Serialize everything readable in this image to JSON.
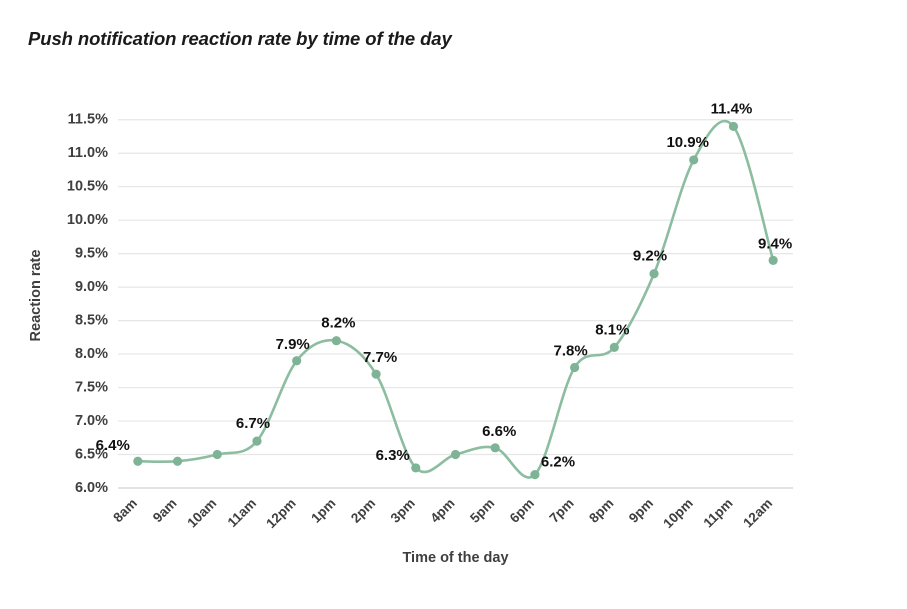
{
  "chart_data": {
    "type": "line",
    "title": "Push notification reaction rate by time of the day",
    "xlabel": "Time of the day",
    "ylabel": "Reaction rate",
    "categories": [
      "8am",
      "9am",
      "10am",
      "11am",
      "12pm",
      "1pm",
      "2pm",
      "3pm",
      "4pm",
      "5pm",
      "6pm",
      "7pm",
      "8pm",
      "9pm",
      "10pm",
      "11pm",
      "12am"
    ],
    "values": [
      6.4,
      6.4,
      6.5,
      6.7,
      7.9,
      8.2,
      7.7,
      6.3,
      6.5,
      6.6,
      6.2,
      7.8,
      8.1,
      9.2,
      10.9,
      11.4,
      9.4
    ],
    "point_labels": [
      "6.4%",
      "",
      "",
      "6.7%",
      "7.9%",
      "8.2%",
      "7.7%",
      "6.3%",
      "",
      "6.6%",
      "6.2%",
      "7.8%",
      "8.1%",
      "9.2%",
      "10.9%",
      "11.4%",
      "9.4%"
    ],
    "ylim": [
      6.0,
      11.75
    ],
    "yticks": [
      6.0,
      6.5,
      7.0,
      7.5,
      8.0,
      8.5,
      9.0,
      9.5,
      10.0,
      10.5,
      11.0,
      11.5
    ],
    "ytick_labels": [
      "6.0%",
      "6.5%",
      "7.0%",
      "7.5%",
      "8.0%",
      "8.5%",
      "9.0%",
      "9.5%",
      "10.0%",
      "10.5%",
      "11.0%",
      "11.5%"
    ],
    "grid": true,
    "legend": "none",
    "series_color": "#8cbda0",
    "marker_color": "#7fb396",
    "label_color": "#111111",
    "axis_color": "#3f3f3f",
    "grid_color": "#e6e6e6",
    "background": "#ffffff",
    "xtick_rotation": -45
  }
}
